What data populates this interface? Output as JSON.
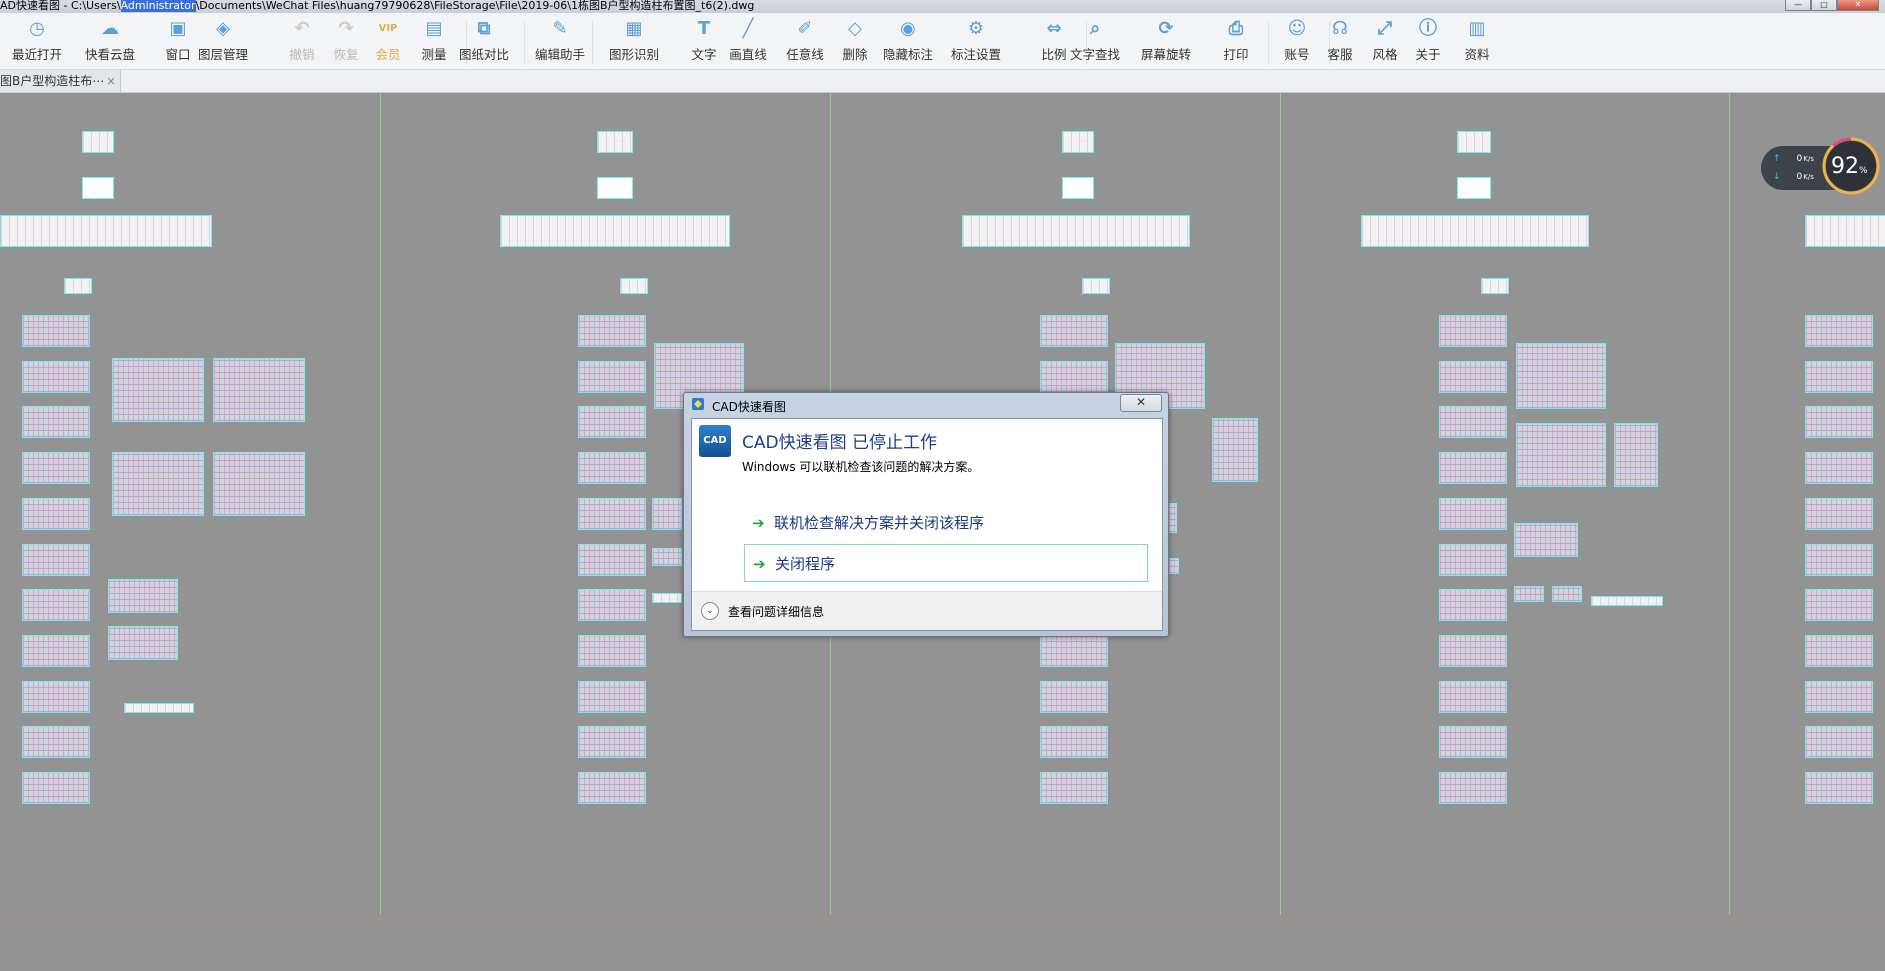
{
  "window": {
    "title_prefix": "AD快速看图 - C:\\Users\\",
    "title_selected": "Administrator",
    "title_suffix": "\\Documents\\WeChat Files\\huang79790628\\FileStorage\\File\\2019-06\\1栋图B户型构造柱布置图_t6(2).dwg",
    "min_label": "—",
    "max_label": "□",
    "close_label": "✕"
  },
  "toolbar": {
    "items": [
      {
        "label": "最近打开",
        "icon": "clock-icon"
      },
      {
        "label": "快看云盘",
        "icon": "cloud-icon"
      },
      {
        "label": "窗口",
        "icon": "window-icon"
      },
      {
        "label": "图层管理",
        "icon": "layers-icon"
      },
      {
        "label": "撤销",
        "icon": "undo-icon"
      },
      {
        "label": "恢复",
        "icon": "redo-icon"
      },
      {
        "label": "会员",
        "icon": "vip-icon"
      },
      {
        "label": "测量",
        "icon": "ruler-icon"
      },
      {
        "label": "图纸对比",
        "icon": "compare-icon"
      },
      {
        "label": "编辑助手",
        "icon": "edit-helper-icon"
      },
      {
        "label": "图形识别",
        "icon": "shape-recognize-icon"
      },
      {
        "label": "文字",
        "icon": "text-icon"
      },
      {
        "label": "画直线",
        "icon": "line-icon"
      },
      {
        "label": "任意线",
        "icon": "freehand-icon"
      },
      {
        "label": "删除",
        "icon": "eraser-icon"
      },
      {
        "label": "隐藏标注",
        "icon": "hide-annotation-icon"
      },
      {
        "label": "标注设置",
        "icon": "annotation-settings-icon"
      },
      {
        "label": "比例",
        "icon": "scale-icon"
      },
      {
        "label": "文字查找",
        "icon": "text-search-icon"
      },
      {
        "label": "屏幕旋转",
        "icon": "rotate-screen-icon"
      },
      {
        "label": "打印",
        "icon": "printer-icon"
      },
      {
        "label": "账号",
        "icon": "user-icon"
      },
      {
        "label": "客服",
        "icon": "headset-icon"
      },
      {
        "label": "风格",
        "icon": "style-icon"
      },
      {
        "label": "关于",
        "icon": "info-icon"
      },
      {
        "label": "资料",
        "icon": "document-icon"
      }
    ]
  },
  "tabs": [
    {
      "label": "图B户型构造柱布⋯",
      "close": "×"
    }
  ],
  "netspeed": {
    "up": "0",
    "down": "0",
    "unit": "K/s",
    "percent": "92",
    "percent_sign": "%"
  },
  "dialog": {
    "title": "CAD快速看图",
    "close_label": "✕",
    "icon_text": "CAD",
    "heading": "CAD快速看图 已停止工作",
    "subtext": "Windows 可以联机检查该问题的解决方案。",
    "option1": "联机检查解决方案并关闭该程序",
    "option2": "关闭程序",
    "option_arrow": "➔",
    "details": "查看问题详细信息",
    "details_chevron": "⌄"
  },
  "colors": {
    "canvas": "#939393",
    "frame_line": "#6ff0f0",
    "divider": "#8fcf8f",
    "dialog_heading": "#1e3e8c",
    "option_arrow": "#1fa83a"
  }
}
